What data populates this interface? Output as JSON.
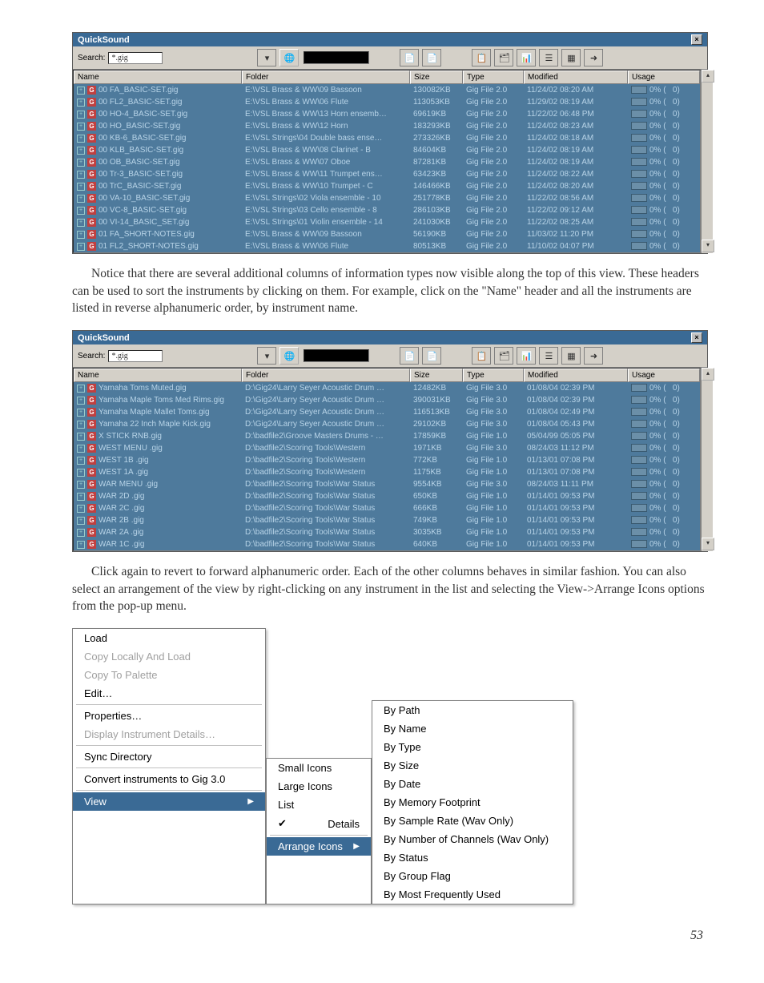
{
  "window": {
    "title": "QuickSound",
    "search_label": "Search:",
    "search_value": "*.gig",
    "headers": [
      "Name",
      "Folder",
      "Size",
      "Type",
      "Modified",
      "Usage"
    ]
  },
  "list1": [
    {
      "name": "00 FA_BASIC-SET.gig",
      "folder": "E:\\VSL Brass & WW\\09 Bassoon",
      "size": "130082KB",
      "type": "Gig File 2.0",
      "mod": "11/24/02 08:20 AM",
      "usage": "0% (",
      "u2": "0)"
    },
    {
      "name": "00 FL2_BASIC-SET.gig",
      "folder": "E:\\VSL Brass & WW\\06 Flute",
      "size": "113053KB",
      "type": "Gig File 2.0",
      "mod": "11/29/02 08:19 AM",
      "usage": "0% (",
      "u2": "0)"
    },
    {
      "name": "00 HO-4_BASIC-SET.gig",
      "folder": "E:\\VSL Brass & WW\\13 Horn ensemb…",
      "size": "69619KB",
      "type": "Gig File 2.0",
      "mod": "11/22/02 06:48 PM",
      "usage": "0% (",
      "u2": "0)"
    },
    {
      "name": "00 HO_BASIC-SET.gig",
      "folder": "E:\\VSL Brass & WW\\12 Horn",
      "size": "183293KB",
      "type": "Gig File 2.0",
      "mod": "11/24/02 08:23 AM",
      "usage": "0% (",
      "u2": "0)"
    },
    {
      "name": "00 KB-6_BASIC-SET.gig",
      "folder": "E:\\VSL Strings\\04 Double bass ense…",
      "size": "273326KB",
      "type": "Gig File 2.0",
      "mod": "11/24/02 08:18 AM",
      "usage": "0% (",
      "u2": "0)"
    },
    {
      "name": "00 KLB_BASIC-SET.gig",
      "folder": "E:\\VSL Brass & WW\\08 Clarinet - B",
      "size": "84604KB",
      "type": "Gig File 2.0",
      "mod": "11/24/02 08:19 AM",
      "usage": "0% (",
      "u2": "0)"
    },
    {
      "name": "00 OB_BASIC-SET.gig",
      "folder": "E:\\VSL Brass & WW\\07 Oboe",
      "size": "87281KB",
      "type": "Gig File 2.0",
      "mod": "11/24/02 08:19 AM",
      "usage": "0% (",
      "u2": "0)"
    },
    {
      "name": "00 Tr-3_BASIC-SET.gig",
      "folder": "E:\\VSL Brass & WW\\11 Trumpet ens…",
      "size": "63423KB",
      "type": "Gig File 2.0",
      "mod": "11/24/02 08:22 AM",
      "usage": "0% (",
      "u2": "0)"
    },
    {
      "name": "00 TrC_BASIC-SET.gig",
      "folder": "E:\\VSL Brass & WW\\10 Trumpet - C",
      "size": "146466KB",
      "type": "Gig File 2.0",
      "mod": "11/24/02 08:20 AM",
      "usage": "0% (",
      "u2": "0)"
    },
    {
      "name": "00 VA-10_BASIC-SET.gig",
      "folder": "E:\\VSL Strings\\02 Viola ensemble - 10",
      "size": "251778KB",
      "type": "Gig File 2.0",
      "mod": "11/22/02 08:56 AM",
      "usage": "0% (",
      "u2": "0)"
    },
    {
      "name": "00 VC-8_BASIC-SET.gig",
      "folder": "E:\\VSL Strings\\03 Cello ensemble - 8",
      "size": "286103KB",
      "type": "Gig File 2.0",
      "mod": "11/22/02 09:12 AM",
      "usage": "0% (",
      "u2": "0)"
    },
    {
      "name": "00 VI-14_BASIC_SET.gig",
      "folder": "E:\\VSL Strings\\01 Violin ensemble - 14",
      "size": "241030KB",
      "type": "Gig File 2.0",
      "mod": "11/22/02 08:25 AM",
      "usage": "0% (",
      "u2": "0)"
    },
    {
      "name": "01 FA_SHORT-NOTES.gig",
      "folder": "E:\\VSL Brass & WW\\09 Bassoon",
      "size": "56190KB",
      "type": "Gig File 2.0",
      "mod": "11/03/02 11:20 PM",
      "usage": "0% (",
      "u2": "0)"
    },
    {
      "name": "01 FL2_SHORT-NOTES.gig",
      "folder": "E:\\VSL Brass & WW\\06 Flute",
      "size": "80513KB",
      "type": "Gig File 2.0",
      "mod": "11/10/02 04:07 PM",
      "usage": "0% (",
      "u2": "0)"
    }
  ],
  "paragraph1": "Notice that there are several additional columns of information types now visible along the top of this view. These headers can be used to sort the instruments by clicking on them. For example, click on the \"Name\" header and all the instruments are listed in reverse alphanumeric order, by instrument name.",
  "list2": [
    {
      "name": "Yamaha Toms Muted.gig",
      "folder": "D:\\Gig24\\Larry Seyer Acoustic Drum …",
      "size": "12482KB",
      "type": "Gig File 3.0",
      "mod": "01/08/04 02:39 PM",
      "usage": "0% (",
      "u2": "0)"
    },
    {
      "name": "Yamaha Maple Toms Med Rims.gig",
      "folder": "D:\\Gig24\\Larry Seyer Acoustic Drum …",
      "size": "390031KB",
      "type": "Gig File 3.0",
      "mod": "01/08/04 02:39 PM",
      "usage": "0% (",
      "u2": "0)"
    },
    {
      "name": "Yamaha Maple Mallet Toms.gig",
      "folder": "D:\\Gig24\\Larry Seyer Acoustic Drum …",
      "size": "116513KB",
      "type": "Gig File 3.0",
      "mod": "01/08/04 02:49 PM",
      "usage": "0% (",
      "u2": "0)"
    },
    {
      "name": "Yamaha 22 Inch Maple Kick.gig",
      "folder": "D:\\Gig24\\Larry Seyer Acoustic Drum …",
      "size": "29102KB",
      "type": "Gig File 3.0",
      "mod": "01/08/04 05:43 PM",
      "usage": "0% (",
      "u2": "0)"
    },
    {
      "name": "X STICK RNB.gig",
      "folder": "D:\\badfile2\\Groove Masters Drums - …",
      "size": "17859KB",
      "type": "Gig File 1.0",
      "mod": "05/04/99 05:05 PM",
      "usage": "0% (",
      "u2": "0)"
    },
    {
      "name": "WEST MENU   .gig",
      "folder": "D:\\badfile2\\Scoring Tools\\Western",
      "size": "1971KB",
      "type": "Gig File 3.0",
      "mod": "08/24/03 11:12 PM",
      "usage": "0% (",
      "u2": "0)"
    },
    {
      "name": "WEST 1B   .gig",
      "folder": "D:\\badfile2\\Scoring Tools\\Western",
      "size": "772KB",
      "type": "Gig File 1.0",
      "mod": "01/13/01 07:08 PM",
      "usage": "0% (",
      "u2": "0)"
    },
    {
      "name": "WEST 1A   .gig",
      "folder": "D:\\badfile2\\Scoring Tools\\Western",
      "size": "1175KB",
      "type": "Gig File 1.0",
      "mod": "01/13/01 07:08 PM",
      "usage": "0% (",
      "u2": "0)"
    },
    {
      "name": "WAR MENU   .gig",
      "folder": "D:\\badfile2\\Scoring Tools\\War Status",
      "size": "9554KB",
      "type": "Gig File 3.0",
      "mod": "08/24/03 11:11 PM",
      "usage": "0% (",
      "u2": "0)"
    },
    {
      "name": "WAR 2D     .gig",
      "folder": "D:\\badfile2\\Scoring Tools\\War Status",
      "size": "650KB",
      "type": "Gig File 1.0",
      "mod": "01/14/01 09:53 PM",
      "usage": "0% (",
      "u2": "0)"
    },
    {
      "name": "WAR 2C     .gig",
      "folder": "D:\\badfile2\\Scoring Tools\\War Status",
      "size": "666KB",
      "type": "Gig File 1.0",
      "mod": "01/14/01 09:53 PM",
      "usage": "0% (",
      "u2": "0)"
    },
    {
      "name": "WAR 2B     .gig",
      "folder": "D:\\badfile2\\Scoring Tools\\War Status",
      "size": "749KB",
      "type": "Gig File 1.0",
      "mod": "01/14/01 09:53 PM",
      "usage": "0% (",
      "u2": "0)"
    },
    {
      "name": "WAR 2A     .gig",
      "folder": "D:\\badfile2\\Scoring Tools\\War Status",
      "size": "3035KB",
      "type": "Gig File 1.0",
      "mod": "01/14/01 09:53 PM",
      "usage": "0% (",
      "u2": "0)"
    },
    {
      "name": "WAR 1C     .gig",
      "folder": "D:\\badfile2\\Scoring Tools\\War Status",
      "size": "640KB",
      "type": "Gig File 1.0",
      "mod": "01/14/01 09:53 PM",
      "usage": "0% (",
      "u2": "0)"
    }
  ],
  "paragraph2": "Click again to revert to forward alphanumeric order. Each of the other columns behaves in similar fashion. You can also select an arrangement of the view by right-clicking on any instrument in the list and selecting the View->Arrange Icons options from the pop-up menu.",
  "menus": {
    "main": [
      {
        "label": "Load",
        "enabled": true
      },
      {
        "label": "Copy Locally And Load",
        "enabled": false
      },
      {
        "label": "Copy To Palette",
        "enabled": false
      },
      {
        "label": "Edit…",
        "enabled": true
      },
      {
        "sep": true
      },
      {
        "label": "Properties…",
        "enabled": true
      },
      {
        "label": "Display Instrument Details…",
        "enabled": false
      },
      {
        "sep": true
      },
      {
        "label": "Sync Directory",
        "enabled": true
      },
      {
        "sep": true
      },
      {
        "label": "Convert instruments to Gig 3.0",
        "enabled": true
      },
      {
        "sep": true
      },
      {
        "label": "View",
        "enabled": true,
        "hl": true,
        "arrow": true
      }
    ],
    "mid": [
      {
        "label": "Small Icons"
      },
      {
        "label": "Large Icons"
      },
      {
        "label": "List"
      },
      {
        "label": "Details",
        "check": true
      },
      {
        "sep": true
      },
      {
        "label": "Arrange Icons",
        "hl": true,
        "arrow": true
      }
    ],
    "right": [
      {
        "label": "By Path"
      },
      {
        "label": "By Name"
      },
      {
        "label": "By Type"
      },
      {
        "label": "By Size"
      },
      {
        "label": "By Date"
      },
      {
        "label": "By Memory Footprint"
      },
      {
        "label": "By Sample Rate (Wav Only)"
      },
      {
        "label": "By Number of Channels (Wav Only)"
      },
      {
        "label": "By Status"
      },
      {
        "label": "By Group Flag"
      },
      {
        "label": "By Most Frequently Used"
      }
    ]
  },
  "page_number": "53"
}
